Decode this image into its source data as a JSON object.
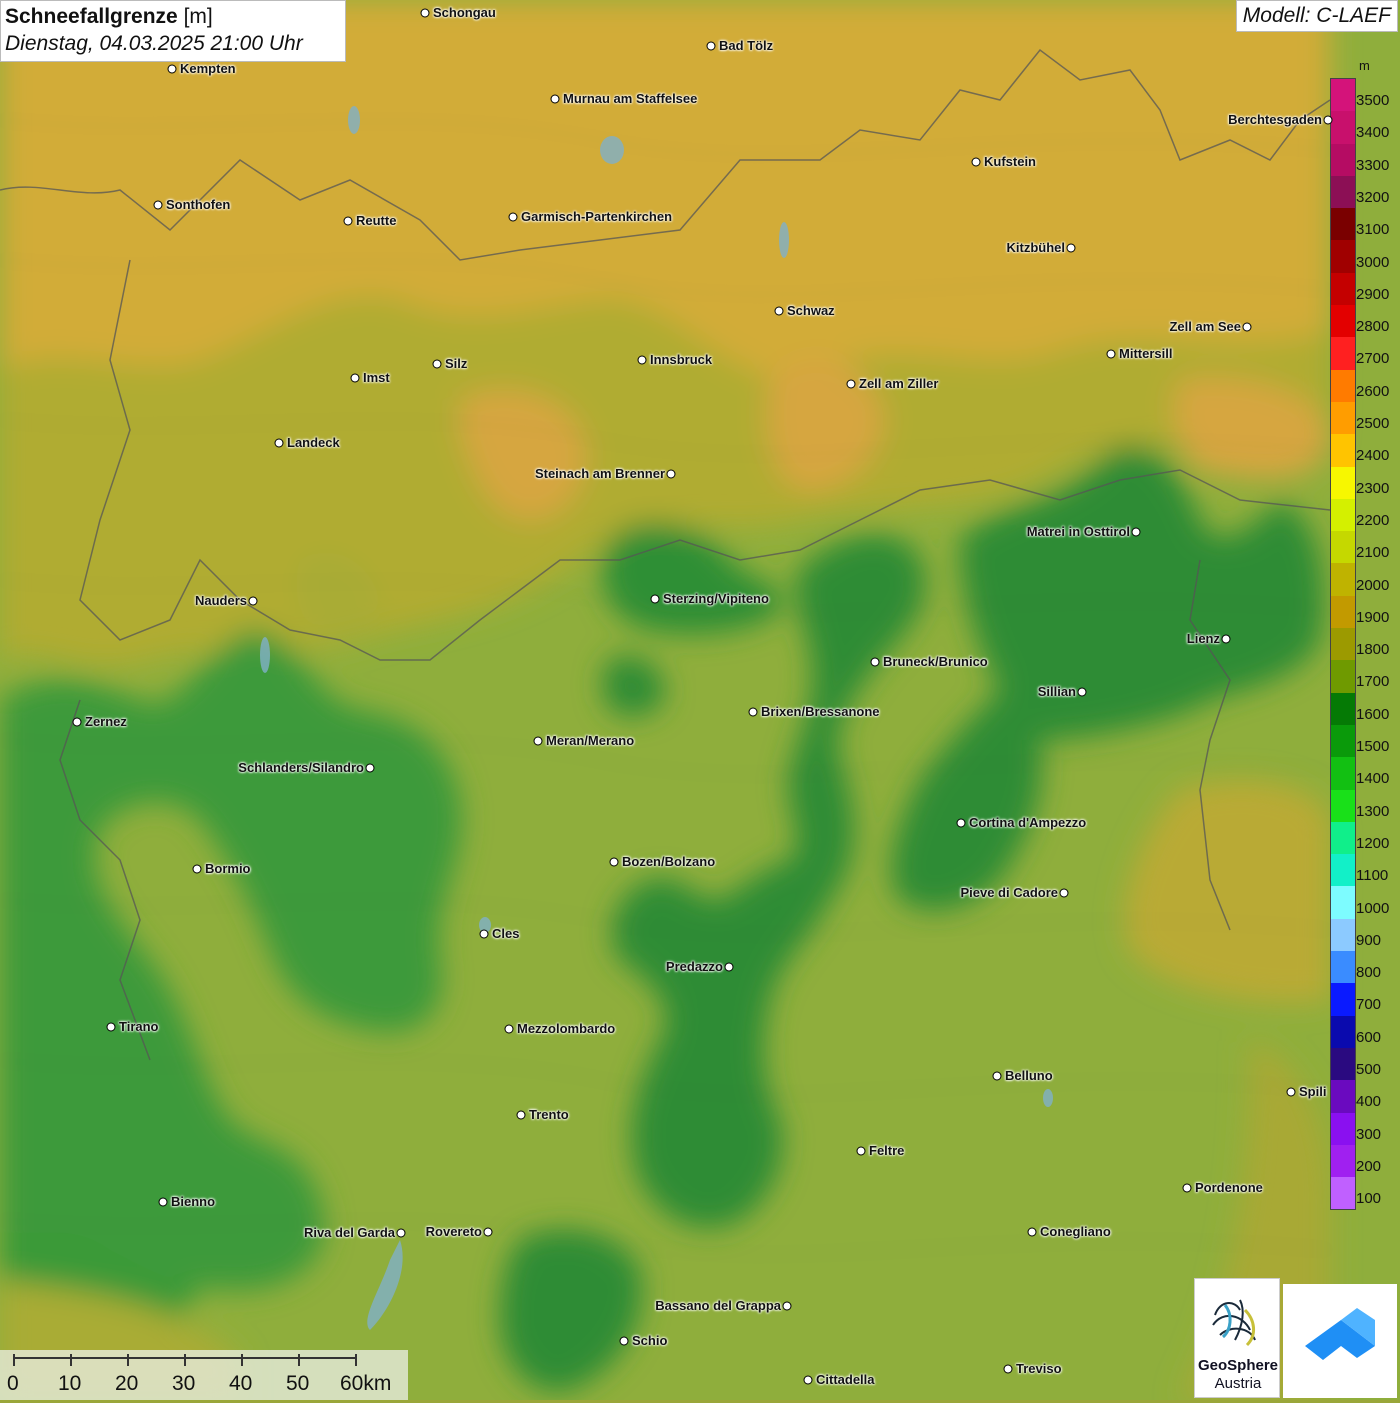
{
  "header": {
    "title": "Schneefallgrenze",
    "unit": "[m]",
    "datetime": "Dienstag, 04.03.2025 21:00 Uhr",
    "model": "Modell: C-LAEF"
  },
  "legend": {
    "unit": "m",
    "levels": [
      {
        "label": "3500",
        "color": "#d4137a"
      },
      {
        "label": "3400",
        "color": "#c8106c"
      },
      {
        "label": "3300",
        "color": "#b50c63"
      },
      {
        "label": "3200",
        "color": "#8c0f55"
      },
      {
        "label": "3100",
        "color": "#7a0000"
      },
      {
        "label": "3000",
        "color": "#a00000"
      },
      {
        "label": "2900",
        "color": "#c40000"
      },
      {
        "label": "2800",
        "color": "#e30000"
      },
      {
        "label": "2700",
        "color": "#ff2020"
      },
      {
        "label": "2600",
        "color": "#ff7b00"
      },
      {
        "label": "2500",
        "color": "#ff9d00"
      },
      {
        "label": "2400",
        "color": "#ffc400"
      },
      {
        "label": "2300",
        "color": "#f7f700"
      },
      {
        "label": "2200",
        "color": "#d4f000"
      },
      {
        "label": "2100",
        "color": "#c5d800"
      },
      {
        "label": "2000",
        "color": "#bfb300"
      },
      {
        "label": "1900",
        "color": "#c29a00"
      },
      {
        "label": "1800",
        "color": "#9c9a00"
      },
      {
        "label": "1700",
        "color": "#6f9a00"
      },
      {
        "label": "1600",
        "color": "#057a05"
      },
      {
        "label": "1500",
        "color": "#0a9a0a"
      },
      {
        "label": "1400",
        "color": "#12c012"
      },
      {
        "label": "1300",
        "color": "#19e019"
      },
      {
        "label": "1200",
        "color": "#10ef8a"
      },
      {
        "label": "1100",
        "color": "#12f0c8"
      },
      {
        "label": "1000",
        "color": "#7dfcff"
      },
      {
        "label": "900",
        "color": "#8ccaff"
      },
      {
        "label": "800",
        "color": "#3a8cff"
      },
      {
        "label": "700",
        "color": "#0a1aff"
      },
      {
        "label": "600",
        "color": "#0a0aae"
      },
      {
        "label": "500",
        "color": "#2a0a80"
      },
      {
        "label": "400",
        "color": "#6a0abf"
      },
      {
        "label": "300",
        "color": "#8a10f0"
      },
      {
        "label": "200",
        "color": "#a020f0"
      },
      {
        "label": "100",
        "color": "#c060ff"
      }
    ]
  },
  "cities": [
    {
      "name": "Schongau",
      "side": "right"
    },
    {
      "name": "Bad Tölz",
      "side": "right"
    },
    {
      "name": "Kempten",
      "side": "right"
    },
    {
      "name": "Murnau am Staffelsee",
      "side": "right"
    },
    {
      "name": "Kufstein",
      "side": "right"
    },
    {
      "name": "Berchtesgaden",
      "side": "left"
    },
    {
      "name": "Sonthofen",
      "side": "right"
    },
    {
      "name": "Reutte",
      "side": "right"
    },
    {
      "name": "Garmisch-Partenkirchen",
      "side": "right"
    },
    {
      "name": "Kitzbühel",
      "side": "left"
    },
    {
      "name": "Schwaz",
      "side": "right"
    },
    {
      "name": "Zell am See",
      "side": "left"
    },
    {
      "name": "Innsbruck",
      "side": "right"
    },
    {
      "name": "Silz",
      "side": "right"
    },
    {
      "name": "Imst",
      "side": "right"
    },
    {
      "name": "Mittersill",
      "side": "right"
    },
    {
      "name": "Zell am Ziller",
      "side": "right"
    },
    {
      "name": "Landeck",
      "side": "right"
    },
    {
      "name": "Steinach am Brenner",
      "side": "left"
    },
    {
      "name": "Matrei in Osttirol",
      "side": "left"
    },
    {
      "name": "Nauders",
      "side": "left"
    },
    {
      "name": "Sterzing/Vipiteno",
      "side": "right"
    },
    {
      "name": "Lienz",
      "side": "left"
    },
    {
      "name": "Bruneck/Brunico",
      "side": "right"
    },
    {
      "name": "Sillian",
      "side": "left"
    },
    {
      "name": "Brixen/Bressanone",
      "side": "right"
    },
    {
      "name": "Zernez",
      "side": "right"
    },
    {
      "name": "Meran/Merano",
      "side": "right"
    },
    {
      "name": "Schlanders/Silandro",
      "side": "left"
    },
    {
      "name": "Cortina d'Ampezzo",
      "side": "right"
    },
    {
      "name": "Bozen/Bolzano",
      "side": "right"
    },
    {
      "name": "Bormio",
      "side": "right"
    },
    {
      "name": "Pieve di Cadore",
      "side": "left"
    },
    {
      "name": "Cles",
      "side": "right"
    },
    {
      "name": "Predazzo",
      "side": "left"
    },
    {
      "name": "Tirano",
      "side": "right"
    },
    {
      "name": "Mezzolombardo",
      "side": "right"
    },
    {
      "name": "Belluno",
      "side": "right"
    },
    {
      "name": "Spili",
      "side": "right"
    },
    {
      "name": "Trento",
      "side": "right"
    },
    {
      "name": "Feltre",
      "side": "right"
    },
    {
      "name": "Pordenone",
      "side": "right"
    },
    {
      "name": "Bienno",
      "side": "right"
    },
    {
      "name": "Riva del Garda",
      "side": "left"
    },
    {
      "name": "Rovereto",
      "side": "left"
    },
    {
      "name": "Conegliano",
      "side": "right"
    },
    {
      "name": "Bassano del Grappa",
      "side": "left"
    },
    {
      "name": "Schio",
      "side": "right"
    },
    {
      "name": "Treviso",
      "side": "right"
    },
    {
      "name": "Cittadella",
      "side": "right"
    }
  ],
  "scale": {
    "labels": [
      "0",
      "10",
      "20",
      "30",
      "40",
      "50",
      "60km"
    ]
  },
  "logos": {
    "geosphere_line1": "GeoSphere",
    "geosphere_line2": "Austria",
    "app_icon": "weather-app-icon"
  },
  "colors": {
    "high_orange": "#d2ac38",
    "mid_olive": "#a9ac34",
    "lower_olive": "#8fad3a",
    "green_low": "#3d9a3a",
    "green_dark": "#2a8a32"
  }
}
